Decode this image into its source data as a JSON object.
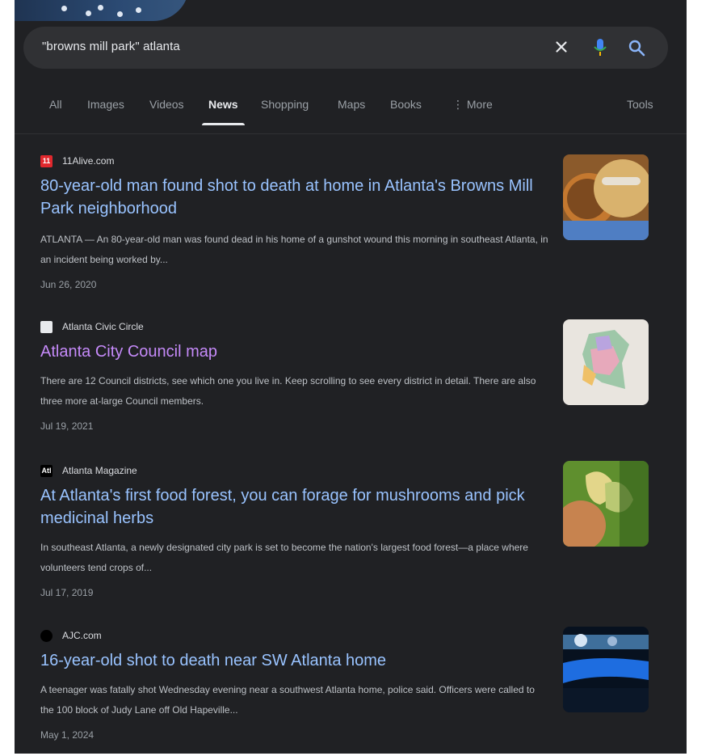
{
  "search": {
    "query": "\"browns mill park\" atlanta"
  },
  "tabs": [
    {
      "label": "All"
    },
    {
      "label": "Images"
    },
    {
      "label": "Videos"
    },
    {
      "label": "News"
    },
    {
      "label": "Shopping"
    },
    {
      "label": "Maps"
    },
    {
      "label": "Books"
    },
    {
      "label": "More"
    }
  ],
  "tools_label": "Tools",
  "results": [
    {
      "source": "11Alive.com",
      "title": "80-year-old man found shot to death at home in Atlanta's Browns Mill Park neighborhood",
      "snippet": "ATLANTA — An 80-year-old man was found dead in his home of a gunshot wound this morning in southeast Atlanta, in an incident being worked by...",
      "date": "Jun 26, 2020",
      "favicon_text": "11",
      "favicon_color": "#e0282d"
    },
    {
      "source": "Atlanta Civic Circle",
      "title": "Atlanta City Council map",
      "snippet": "There are 12 Council districts, see which one you live in. Keep scrolling to see every district in detail. There are also three more at-large Council members.",
      "date": "Jul 19, 2021",
      "favicon_text": "",
      "favicon_color": "#e8eaed"
    },
    {
      "source": "Atlanta Magazine",
      "title": "At Atlanta's first food forest, you can forage for mushrooms and pick medicinal herbs",
      "snippet": "In southeast Atlanta, a newly designated city park is set to become the nation's largest food forest—a place where volunteers tend crops of...",
      "date": "Jul 17, 2019",
      "favicon_text": "Atl",
      "favicon_color": "#000000"
    },
    {
      "source": "AJC.com",
      "title": "16-year-old shot to death near SW Atlanta home",
      "snippet": "A teenager was fatally shot Wednesday evening near a southwest Atlanta home, police said. Officers were called to the 100 block of Judy Lane off Old Hapeville...",
      "date": "May 1, 2024",
      "favicon_text": "",
      "favicon_color": "#000000"
    }
  ]
}
